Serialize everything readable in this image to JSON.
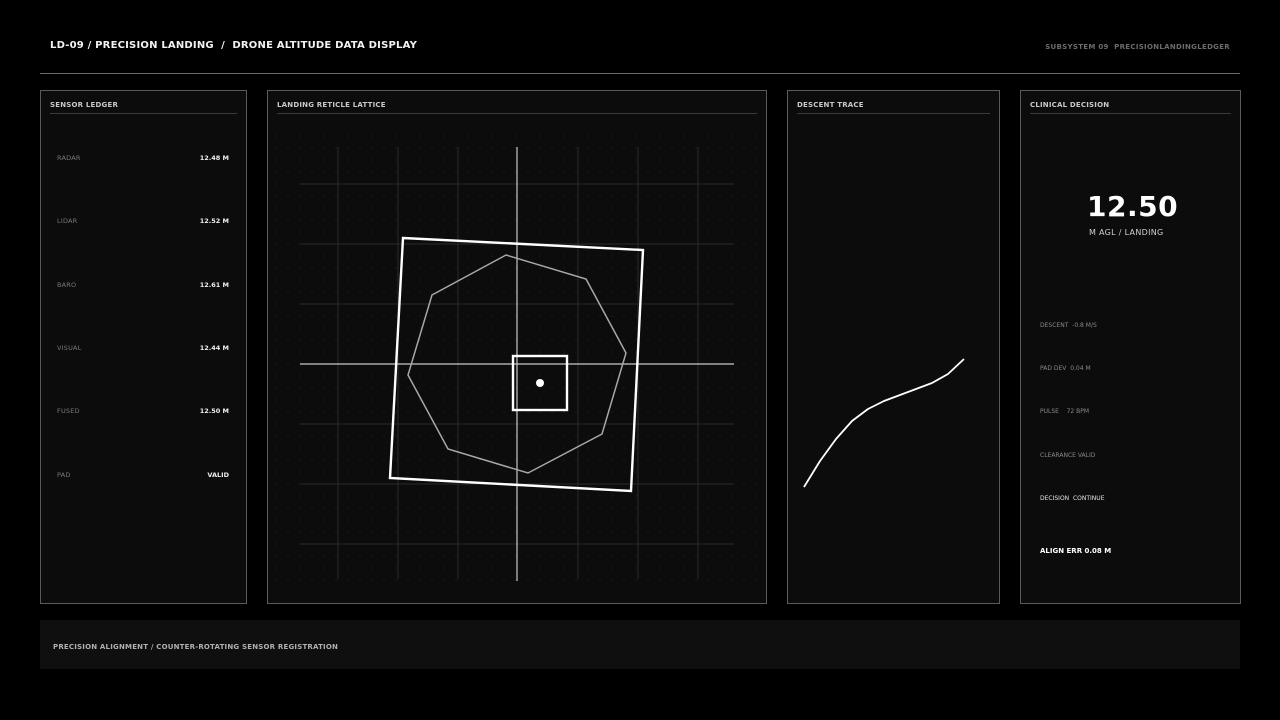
{
  "header": {
    "title": "LD-09 / PRECISION LANDING  /  DRONE ALTITUDE DATA DISPLAY",
    "subsystem": "SUBSYSTEM 09  PRECISIONLANDINGLEDGER"
  },
  "sensor_ledger": {
    "title": "SENSOR LEDGER",
    "rows": [
      {
        "label": "RADAR",
        "value": "12.48 M"
      },
      {
        "label": "LIDAR",
        "value": "12.52 M"
      },
      {
        "label": "BARO",
        "value": "12.61 M"
      },
      {
        "label": "VISUAL",
        "value": "12.44 M"
      },
      {
        "label": "FUSED",
        "value": "12.50 M"
      },
      {
        "label": "PAD",
        "value": "VALID"
      }
    ]
  },
  "reticle": {
    "title": "LANDING RETICLE LATTICE"
  },
  "descent": {
    "title": "DESCENT TRACE"
  },
  "decision": {
    "title": "CLINICAL DECISION",
    "altitude": "12.50",
    "unit": "M AGL / LANDING",
    "rows": [
      {
        "text": "DESCENT  -0.8 M/S"
      },
      {
        "text": "PAD DEV  0.04 M"
      },
      {
        "text": "PULSE    72 BPM"
      },
      {
        "text": "CLEARANCE VALID"
      },
      {
        "text": "DECISION  CONTINUE"
      },
      {
        "text": "ALIGN ERR 0.08 M"
      }
    ]
  },
  "footer": {
    "text": "PRECISION ALIGNMENT / COUNTER-ROTATING SENSOR REGISTRATION"
  }
}
